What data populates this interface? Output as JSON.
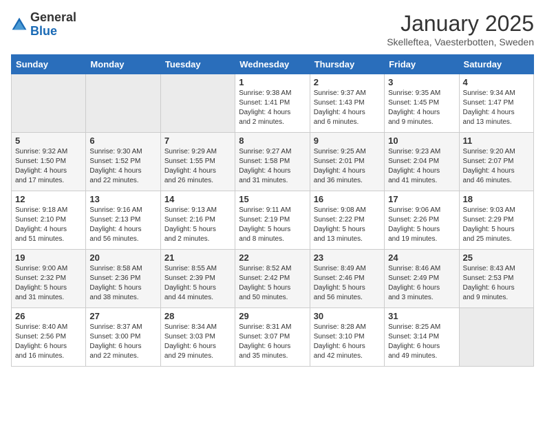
{
  "logo": {
    "general": "General",
    "blue": "Blue"
  },
  "title": "January 2025",
  "subtitle": "Skelleftea, Vaesterbotten, Sweden",
  "weekdays": [
    "Sunday",
    "Monday",
    "Tuesday",
    "Wednesday",
    "Thursday",
    "Friday",
    "Saturday"
  ],
  "weeks": [
    [
      {
        "day": "",
        "info": ""
      },
      {
        "day": "",
        "info": ""
      },
      {
        "day": "",
        "info": ""
      },
      {
        "day": "1",
        "info": "Sunrise: 9:38 AM\nSunset: 1:41 PM\nDaylight: 4 hours\nand 2 minutes."
      },
      {
        "day": "2",
        "info": "Sunrise: 9:37 AM\nSunset: 1:43 PM\nDaylight: 4 hours\nand 6 minutes."
      },
      {
        "day": "3",
        "info": "Sunrise: 9:35 AM\nSunset: 1:45 PM\nDaylight: 4 hours\nand 9 minutes."
      },
      {
        "day": "4",
        "info": "Sunrise: 9:34 AM\nSunset: 1:47 PM\nDaylight: 4 hours\nand 13 minutes."
      }
    ],
    [
      {
        "day": "5",
        "info": "Sunrise: 9:32 AM\nSunset: 1:50 PM\nDaylight: 4 hours\nand 17 minutes."
      },
      {
        "day": "6",
        "info": "Sunrise: 9:30 AM\nSunset: 1:52 PM\nDaylight: 4 hours\nand 22 minutes."
      },
      {
        "day": "7",
        "info": "Sunrise: 9:29 AM\nSunset: 1:55 PM\nDaylight: 4 hours\nand 26 minutes."
      },
      {
        "day": "8",
        "info": "Sunrise: 9:27 AM\nSunset: 1:58 PM\nDaylight: 4 hours\nand 31 minutes."
      },
      {
        "day": "9",
        "info": "Sunrise: 9:25 AM\nSunset: 2:01 PM\nDaylight: 4 hours\nand 36 minutes."
      },
      {
        "day": "10",
        "info": "Sunrise: 9:23 AM\nSunset: 2:04 PM\nDaylight: 4 hours\nand 41 minutes."
      },
      {
        "day": "11",
        "info": "Sunrise: 9:20 AM\nSunset: 2:07 PM\nDaylight: 4 hours\nand 46 minutes."
      }
    ],
    [
      {
        "day": "12",
        "info": "Sunrise: 9:18 AM\nSunset: 2:10 PM\nDaylight: 4 hours\nand 51 minutes."
      },
      {
        "day": "13",
        "info": "Sunrise: 9:16 AM\nSunset: 2:13 PM\nDaylight: 4 hours\nand 56 minutes."
      },
      {
        "day": "14",
        "info": "Sunrise: 9:13 AM\nSunset: 2:16 PM\nDaylight: 5 hours\nand 2 minutes."
      },
      {
        "day": "15",
        "info": "Sunrise: 9:11 AM\nSunset: 2:19 PM\nDaylight: 5 hours\nand 8 minutes."
      },
      {
        "day": "16",
        "info": "Sunrise: 9:08 AM\nSunset: 2:22 PM\nDaylight: 5 hours\nand 13 minutes."
      },
      {
        "day": "17",
        "info": "Sunrise: 9:06 AM\nSunset: 2:26 PM\nDaylight: 5 hours\nand 19 minutes."
      },
      {
        "day": "18",
        "info": "Sunrise: 9:03 AM\nSunset: 2:29 PM\nDaylight: 5 hours\nand 25 minutes."
      }
    ],
    [
      {
        "day": "19",
        "info": "Sunrise: 9:00 AM\nSunset: 2:32 PM\nDaylight: 5 hours\nand 31 minutes."
      },
      {
        "day": "20",
        "info": "Sunrise: 8:58 AM\nSunset: 2:36 PM\nDaylight: 5 hours\nand 38 minutes."
      },
      {
        "day": "21",
        "info": "Sunrise: 8:55 AM\nSunset: 2:39 PM\nDaylight: 5 hours\nand 44 minutes."
      },
      {
        "day": "22",
        "info": "Sunrise: 8:52 AM\nSunset: 2:42 PM\nDaylight: 5 hours\nand 50 minutes."
      },
      {
        "day": "23",
        "info": "Sunrise: 8:49 AM\nSunset: 2:46 PM\nDaylight: 5 hours\nand 56 minutes."
      },
      {
        "day": "24",
        "info": "Sunrise: 8:46 AM\nSunset: 2:49 PM\nDaylight: 6 hours\nand 3 minutes."
      },
      {
        "day": "25",
        "info": "Sunrise: 8:43 AM\nSunset: 2:53 PM\nDaylight: 6 hours\nand 9 minutes."
      }
    ],
    [
      {
        "day": "26",
        "info": "Sunrise: 8:40 AM\nSunset: 2:56 PM\nDaylight: 6 hours\nand 16 minutes."
      },
      {
        "day": "27",
        "info": "Sunrise: 8:37 AM\nSunset: 3:00 PM\nDaylight: 6 hours\nand 22 minutes."
      },
      {
        "day": "28",
        "info": "Sunrise: 8:34 AM\nSunset: 3:03 PM\nDaylight: 6 hours\nand 29 minutes."
      },
      {
        "day": "29",
        "info": "Sunrise: 8:31 AM\nSunset: 3:07 PM\nDaylight: 6 hours\nand 35 minutes."
      },
      {
        "day": "30",
        "info": "Sunrise: 8:28 AM\nSunset: 3:10 PM\nDaylight: 6 hours\nand 42 minutes."
      },
      {
        "day": "31",
        "info": "Sunrise: 8:25 AM\nSunset: 3:14 PM\nDaylight: 6 hours\nand 49 minutes."
      },
      {
        "day": "",
        "info": ""
      }
    ]
  ]
}
